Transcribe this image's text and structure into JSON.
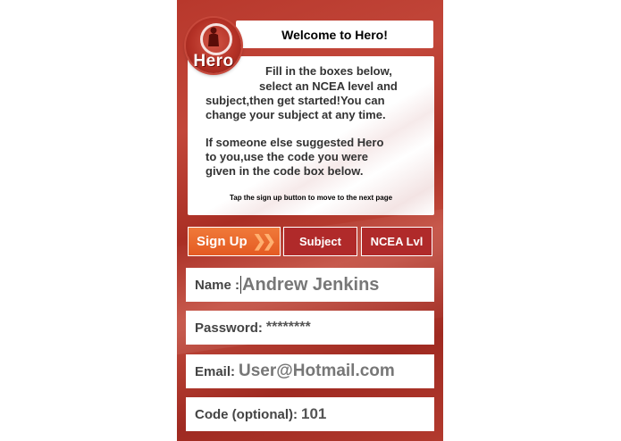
{
  "header": {
    "welcome_text": "Welcome to Hero!",
    "logo_text": "Hero"
  },
  "intro": {
    "lines": [
      "Fill in the boxes below,",
      "select an NCEA level and",
      "subject,then get started!You can",
      "change your subject at any time.",
      "If someone else suggested Hero",
      "to you,use the code you were",
      "given in the code box below."
    ],
    "tap_hint": "Tap the sign up button to move to the next page"
  },
  "tabs": {
    "signup_label": "Sign Up",
    "signup_icon": "double-chevron-right-icon",
    "subject_label": "Subject",
    "ncea_label": "NCEA Lvl"
  },
  "form": {
    "name_label": "Name :",
    "name_value": "Andrew Jenkins",
    "password_label": "Password: ",
    "password_value": "********",
    "email_label": "Email: ",
    "email_value": "User@Hotmail.com",
    "code_label": "Code (optional): ",
    "code_value": "101"
  },
  "colors": {
    "background_red": "#b23a2e",
    "signup_orange": "#e45a22",
    "tab_red": "#b02a2a"
  }
}
